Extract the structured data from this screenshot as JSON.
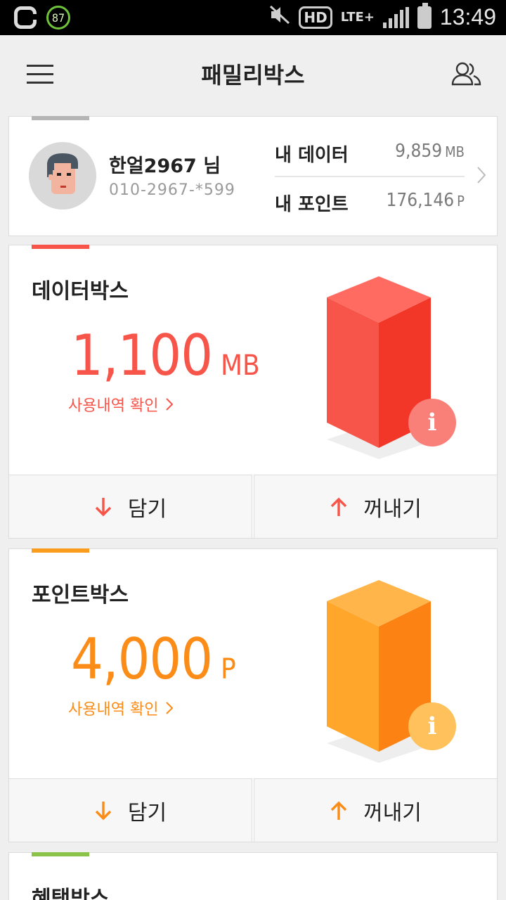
{
  "status_bar": {
    "battery_badge": "87",
    "network": "HD",
    "lte": "LTE+",
    "time": "13:49"
  },
  "app_bar": {
    "title": "패밀리박스"
  },
  "profile": {
    "name": "한얼2967 님",
    "phone": "010-2967-*599",
    "my_data_label": "내 데이터",
    "my_data_value": "9,859",
    "my_data_unit": "MB",
    "my_points_label": "내 포인트",
    "my_points_value": "176,146",
    "my_points_unit": "P"
  },
  "data_box": {
    "title": "데이터박스",
    "amount": "1,100",
    "unit": "MB",
    "history_link": "사용내역 확인",
    "info": "i",
    "deposit_label": "담기",
    "withdraw_label": "꺼내기",
    "accent_color": "#f7554a"
  },
  "point_box": {
    "title": "포인트박스",
    "amount": "4,000",
    "unit": "P",
    "history_link": "사용내역 확인",
    "info": "i",
    "deposit_label": "담기",
    "withdraw_label": "꺼내기",
    "accent_color": "#fb8c17"
  },
  "benefit_box": {
    "title": "혜택박스",
    "accent_color": "#8bc34a"
  },
  "icons": {
    "menu": "hamburger-icon",
    "family": "people-icon",
    "down": "arrow-down-icon",
    "up": "arrow-up-icon",
    "chevron": "chevron-right-icon"
  }
}
